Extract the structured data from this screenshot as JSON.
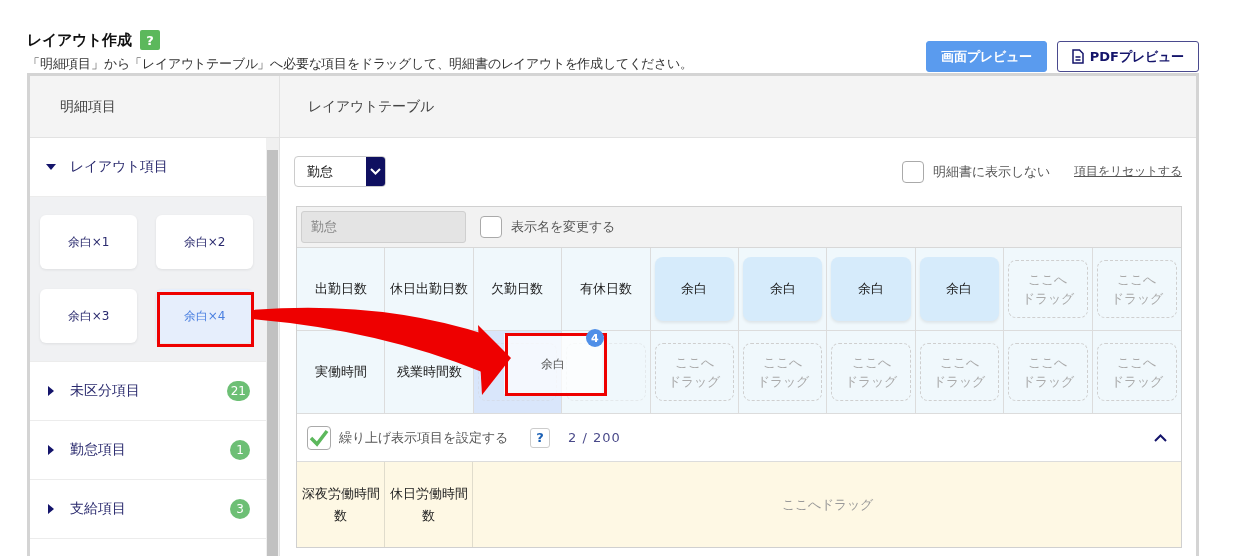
{
  "header": {
    "title": "レイアウト作成",
    "help_label": "?",
    "description": "「明細項目」から「レイアウトテーブル」へ必要な項目をドラッグして、明細書のレイアウトを作成してください。"
  },
  "buttons": [
    {
      "label": "画面プレビュー",
      "kind": "primary"
    },
    {
      "label": "PDFプレビュー",
      "kind": "outline"
    }
  ],
  "left_panel": {
    "heading": "明細項目",
    "groups": [
      {
        "label": "レイアウト項目",
        "expanded": true,
        "items": [
          {
            "label": "余白×1",
            "selected": false
          },
          {
            "label": "余白×2",
            "selected": false
          },
          {
            "label": "余白×3",
            "selected": false
          },
          {
            "label": "余白×4",
            "selected": true
          }
        ]
      },
      {
        "label": "未区分項目",
        "expanded": false,
        "count": "21"
      },
      {
        "label": "勤怠項目",
        "expanded": false,
        "count": "1"
      },
      {
        "label": "支給項目",
        "expanded": false,
        "count": "3"
      }
    ]
  },
  "right_panel": {
    "heading": "レイアウトテーブル",
    "category_select": {
      "value": "勤怠"
    },
    "hide_checkbox": {
      "label": "明細書に表示しない",
      "checked": false
    },
    "reset_link": "項目をリセットする",
    "table": {
      "name_field": {
        "value": "勤怠"
      },
      "rename_checkbox": {
        "label": "表示名を変更する",
        "checked": false
      },
      "rows": [
        [
          {
            "kind": "item",
            "label": "出勤日数",
            "highlighted": false
          },
          {
            "kind": "item",
            "label": "休日出勤日数",
            "highlighted": false
          },
          {
            "kind": "item",
            "label": "欠勤日数",
            "highlighted": false
          },
          {
            "kind": "item",
            "label": "有休日数",
            "highlighted": false
          },
          {
            "kind": "spacer",
            "label": "余白",
            "highlighted": false
          },
          {
            "kind": "spacer",
            "label": "余白",
            "highlighted": false
          },
          {
            "kind": "spacer",
            "label": "余白",
            "highlighted": false
          },
          {
            "kind": "spacer",
            "label": "余白",
            "highlighted": false
          },
          {
            "kind": "empty",
            "lines": [
              "ここへ",
              "ドラッグ"
            ],
            "highlighted": false
          },
          {
            "kind": "empty",
            "lines": [
              "ここへ",
              "ドラッグ"
            ],
            "highlighted": false
          }
        ],
        [
          {
            "kind": "item",
            "label": "実働時間",
            "highlighted": false
          },
          {
            "kind": "item",
            "label": "残業時間数",
            "highlighted": false
          },
          {
            "kind": "empty",
            "highlighted": true
          },
          {
            "kind": "empty",
            "highlighted": false
          },
          {
            "kind": "empty",
            "lines": [
              "ここへ",
              "ドラッグ"
            ],
            "highlighted": false
          },
          {
            "kind": "empty",
            "lines": [
              "ここへ",
              "ドラッグ"
            ],
            "highlighted": false
          },
          {
            "kind": "empty",
            "lines": [
              "ここへ",
              "ドラッグ"
            ],
            "highlighted": false
          },
          {
            "kind": "empty",
            "lines": [
              "ここへ",
              "ドラッグ"
            ],
            "highlighted": false
          },
          {
            "kind": "empty",
            "lines": [
              "ここへ",
              "ドラッグ"
            ],
            "highlighted": false
          },
          {
            "kind": "empty",
            "lines": [
              "ここへ",
              "ドラッグ"
            ],
            "highlighted": false
          }
        ]
      ],
      "drag_ghost": {
        "label": "余白",
        "badge": "4"
      }
    },
    "carry_section": {
      "checkbox": {
        "label": "繰り上げ表示項目を設定する",
        "checked": true
      },
      "help_label": "?",
      "count": "2 / 200",
      "expanded": true,
      "cells": [
        "深夜労働時間数",
        "休日労働時間数"
      ],
      "drop_text": "ここへドラッグ"
    }
  }
}
